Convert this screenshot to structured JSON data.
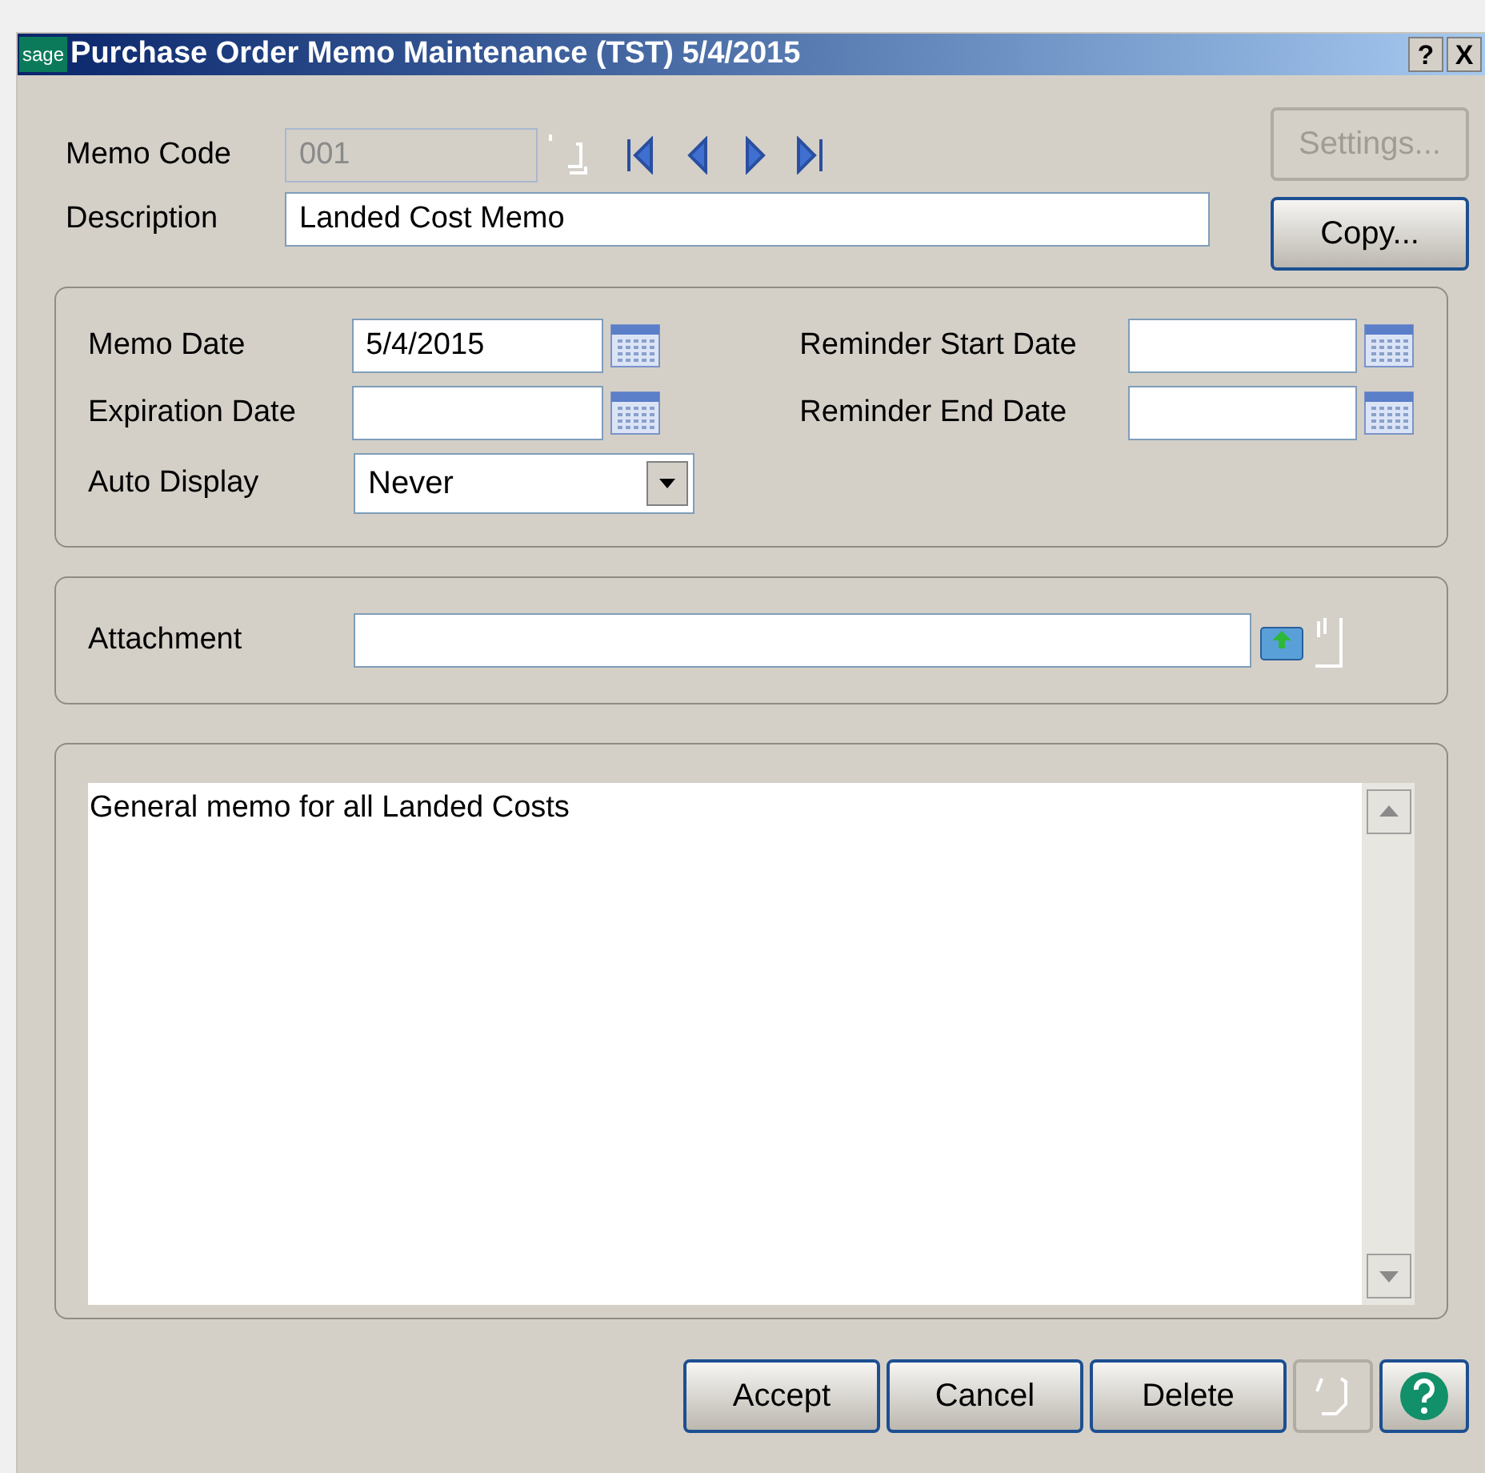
{
  "window": {
    "title": "Purchase Order Memo Maintenance (TST) 5/4/2015",
    "logo": "sage",
    "title_buttons": [
      "?",
      "X"
    ]
  },
  "memo_code": {
    "label": "Memo Code",
    "value": "001",
    "disabled": true
  },
  "description": {
    "label": "Description",
    "value": "Landed Cost Memo"
  },
  "side_buttons": [
    {
      "label": "Settings...",
      "disabled": true
    },
    {
      "label": "Copy...",
      "disabled": false
    }
  ],
  "dates": [
    {
      "label": "Memo Date",
      "value": "5/4/2015"
    },
    {
      "label": "Reminder Start Date"
    },
    {
      "label": "Expiration Date"
    },
    {
      "label": "Reminder End Date"
    }
  ],
  "auto_display": {
    "label": "Auto Display",
    "value": "Never"
  },
  "attachment": {
    "label": "Attachment"
  },
  "memo_text": "General memo for all Landed Costs",
  "buttons": [
    {
      "label": "Accept",
      "kind": "text",
      "disabled": false
    },
    {
      "label": "Cancel",
      "kind": "text",
      "disabled": false
    },
    {
      "label": "Delete",
      "kind": "text",
      "disabled": false
    },
    {
      "kind": "lookup",
      "disabled": true
    },
    {
      "kind": "help",
      "disabled": false
    }
  ]
}
